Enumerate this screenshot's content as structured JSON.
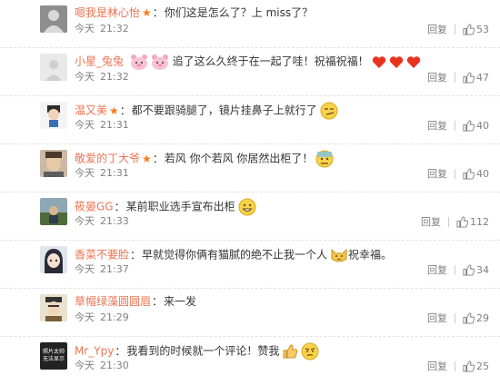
{
  "ui": {
    "reply_label": "回复",
    "colors": {
      "username": "#eb7350",
      "meta": "#808080",
      "star": "#f37b1d",
      "heart": "#e8341d"
    }
  },
  "comments": [
    {
      "user": "嗯我是林心怡",
      "vip": true,
      "sep": "：",
      "text": "你们这是怎么了？上 miss了？",
      "emojis": [],
      "date": "今天",
      "time": "21:32",
      "likes": "53",
      "avatar_icon": "gray-silhouette-avatar"
    },
    {
      "user": "小星_兔兔",
      "vip": false,
      "lead_emojis": [
        "pink-pig-emoji",
        "pink-pig-emoji"
      ],
      "sep": "",
      "text": "追了这么久终于在一起了哇！祝福祝福！",
      "emojis": [
        "heart-emoji",
        "heart-emoji",
        "heart-emoji"
      ],
      "date": "今天",
      "time": "21:32",
      "likes": "47",
      "avatar_icon": "default-gray-avatar"
    },
    {
      "user": "温又美",
      "vip": true,
      "sep": "：",
      "text": "都不要跟骑腿了，镜片挂鼻子上就行了",
      "emojis": [
        "smirk-face-emoji"
      ],
      "date": "今天",
      "time": "21:31",
      "likes": "40",
      "avatar_icon": "cartoon-avatar"
    },
    {
      "user": "敬爱的丁大爷",
      "vip": true,
      "sep": "：",
      "text": "若风 你个若风 你居然出柜了！",
      "emojis": [
        "sweat-face-emoji"
      ],
      "date": "今天",
      "time": "21:31",
      "likes": "40",
      "avatar_icon": "portrait-photo-avatar"
    },
    {
      "user": "筱晏GG",
      "vip": false,
      "sep": "：",
      "text": "某前职业选手宣布出柜",
      "emojis": [
        "grin-face-emoji"
      ],
      "date": "今天",
      "time": "21:33",
      "likes": "112",
      "avatar_icon": "landscape-photo-avatar"
    },
    {
      "user": "香菜不要脸",
      "vip": false,
      "sep": "：",
      "text": "早就觉得你俩有猫腻的绝不止我一个人",
      "emojis": [
        "cat-face-emoji"
      ],
      "text_after": "祝幸福。",
      "date": "今天",
      "time": "21:37",
      "likes": "34",
      "avatar_icon": "anime-girl-avatar"
    },
    {
      "user": "草帽绿藻圆圆眉",
      "vip": false,
      "sep": "：",
      "text": "来一发",
      "emojis": [],
      "date": "今天",
      "time": "21:29",
      "likes": "29",
      "avatar_icon": "anime-character-avatar"
    },
    {
      "user": "Mr_Ypy",
      "vip": false,
      "sep": "：",
      "text": "我看到的时候就一个评论！赞我",
      "emojis": [
        "thumbs-up-emoji",
        "skeptical-face-emoji"
      ],
      "date": "今天",
      "time": "21:30",
      "likes": "25",
      "avatar_icon": "text-image-avatar",
      "avatar_text": [
        "照片太帅",
        "无法显示"
      ]
    }
  ]
}
